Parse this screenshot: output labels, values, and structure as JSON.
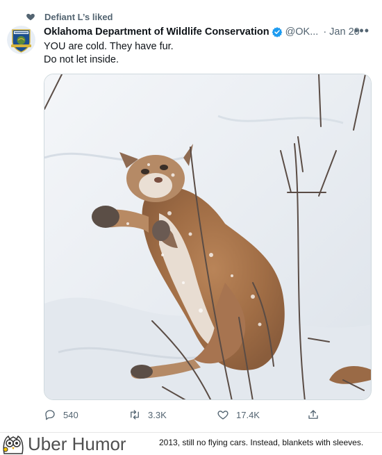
{
  "social_context": {
    "label": "Defiant L’s liked",
    "icon": "heart-icon"
  },
  "tweet": {
    "display_name": "Oklahoma Department of Wildlife Conservation",
    "handle": "@OK...",
    "separator": "·",
    "date": "Jan 20",
    "more": "•••",
    "text_lines": [
      "YOU are cold. They have fur.",
      "Do not let inside."
    ],
    "avatar_badge_text": "OKLAHOMA"
  },
  "actions": {
    "replies": "540",
    "retweets": "3.3K",
    "likes": "17.4K"
  },
  "footer": {
    "brand": "Uber Humor",
    "caption": "2013, still no flying cars. Instead, blankets with sleeves."
  },
  "colors": {
    "text_primary": "#0f1419",
    "text_secondary": "#536471",
    "verified_blue": "#1d9bf0",
    "avatar_blue": "#1b4e8f",
    "avatar_gold": "#d8b43a"
  }
}
